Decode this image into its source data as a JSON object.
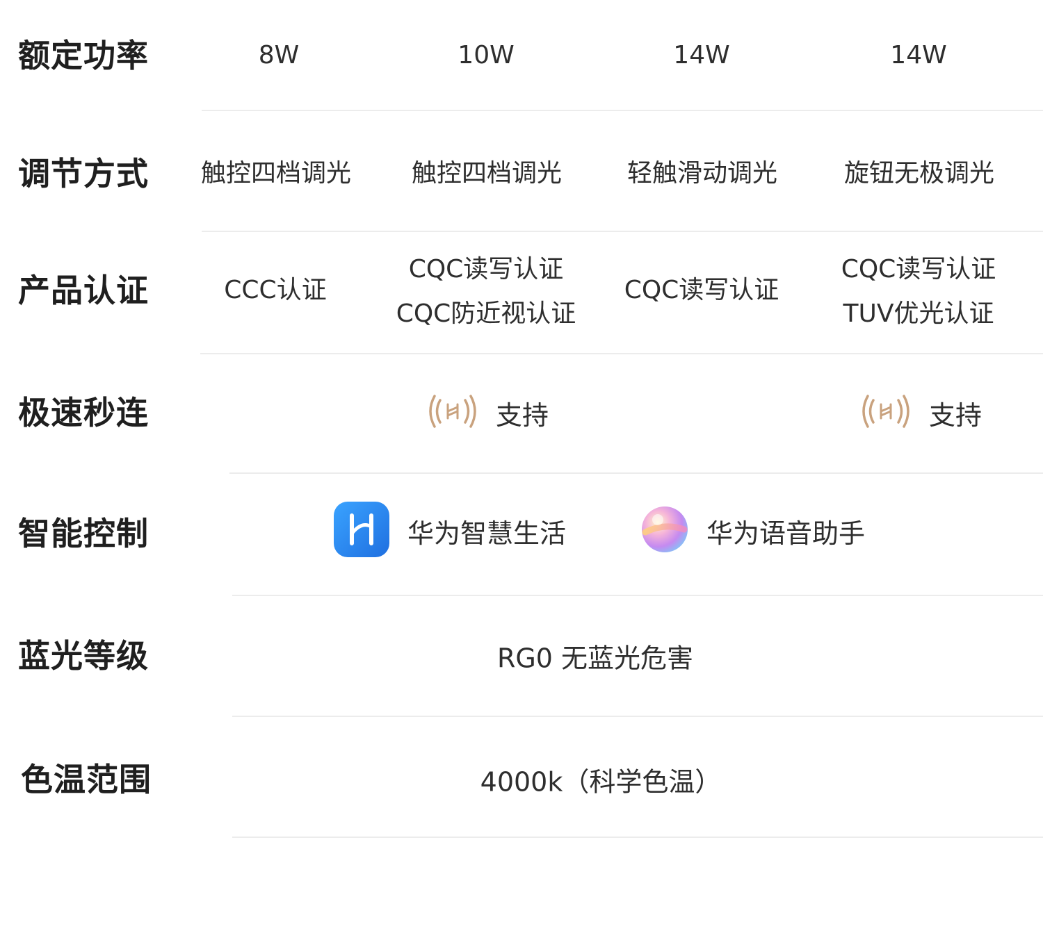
{
  "rows": {
    "power": {
      "label": "额定功率",
      "values": [
        "8W",
        "10W",
        "14W",
        "14W"
      ]
    },
    "dimming": {
      "label": "调节方式",
      "values": [
        "触控四档调光",
        "触控四档调光",
        "轻触滑动调光",
        "旋钮无极调光"
      ]
    },
    "certification": {
      "label": "产品认证",
      "values": [
        [
          "CCC认证"
        ],
        [
          "CQC读写认证",
          "CQC防近视认证"
        ],
        [
          "CQC读写认证"
        ],
        [
          "CQC读写认证",
          "TUV优光认证"
        ]
      ]
    },
    "fast_connect": {
      "label": "极速秒连",
      "support_text": "支持",
      "icon": "harmony-connect-icon",
      "icon_color": "#c9a27e"
    },
    "smart_control": {
      "label": "智能控制",
      "apps": [
        {
          "name": "华为智慧生活",
          "icon": "huawei-ai-life-app-icon",
          "color": "#2b8cf2"
        },
        {
          "name": "华为语音助手",
          "icon": "huawei-voice-assistant-icon",
          "color": "#e88ad0"
        }
      ]
    },
    "blue_light": {
      "label": "蓝光等级",
      "value": "RG0 无蓝光危害"
    },
    "color_temp": {
      "label": "色温范围",
      "value": "4000k（科学色温）"
    }
  }
}
